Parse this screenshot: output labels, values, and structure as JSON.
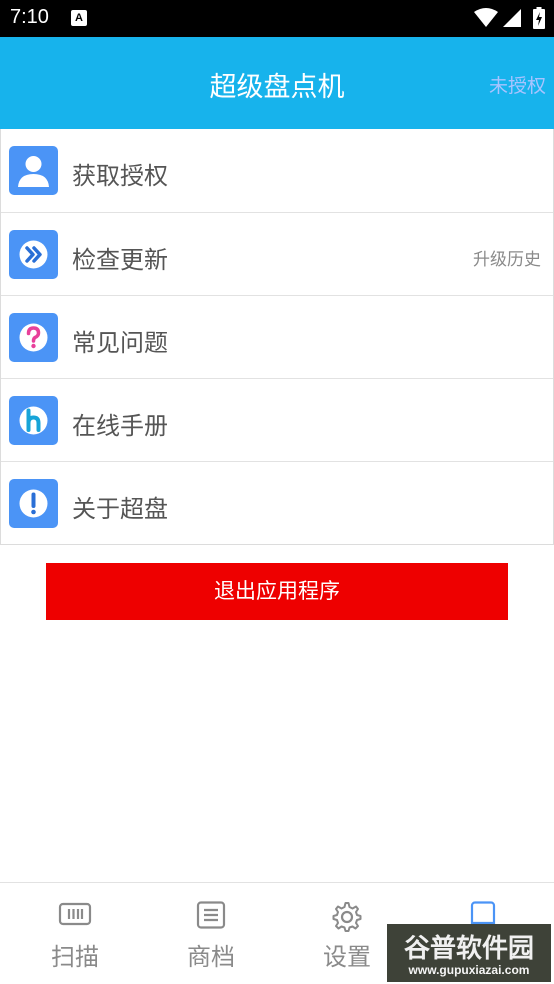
{
  "status_bar": {
    "time": "7:10",
    "notification_icon": "A"
  },
  "header": {
    "title": "超级盘点机",
    "auth_status": "未授权"
  },
  "menu": [
    {
      "label": "获取授权",
      "icon": "user-icon"
    },
    {
      "label": "检查更新",
      "icon": "forward-icon",
      "right_label": "升级历史"
    },
    {
      "label": "常见问题",
      "icon": "question-icon"
    },
    {
      "label": "在线手册",
      "icon": "h-icon"
    },
    {
      "label": "关于超盘",
      "icon": "info-icon"
    }
  ],
  "exit_button": {
    "label": "退出应用程序"
  },
  "bottom_nav": [
    {
      "label": "扫描",
      "icon": "barcode-icon"
    },
    {
      "label": "商档",
      "icon": "list-icon"
    },
    {
      "label": "设置",
      "icon": "gear-icon"
    },
    {
      "label": "",
      "icon": "book-icon",
      "active": true
    }
  ],
  "watermark": {
    "main": "谷普软件园",
    "url": "www.gupuxiazai.com"
  },
  "colors": {
    "header": "#17b3ec",
    "icon_bg": "#4b94f6",
    "exit": "#ee0000",
    "active_tab": "#4b94f6"
  }
}
